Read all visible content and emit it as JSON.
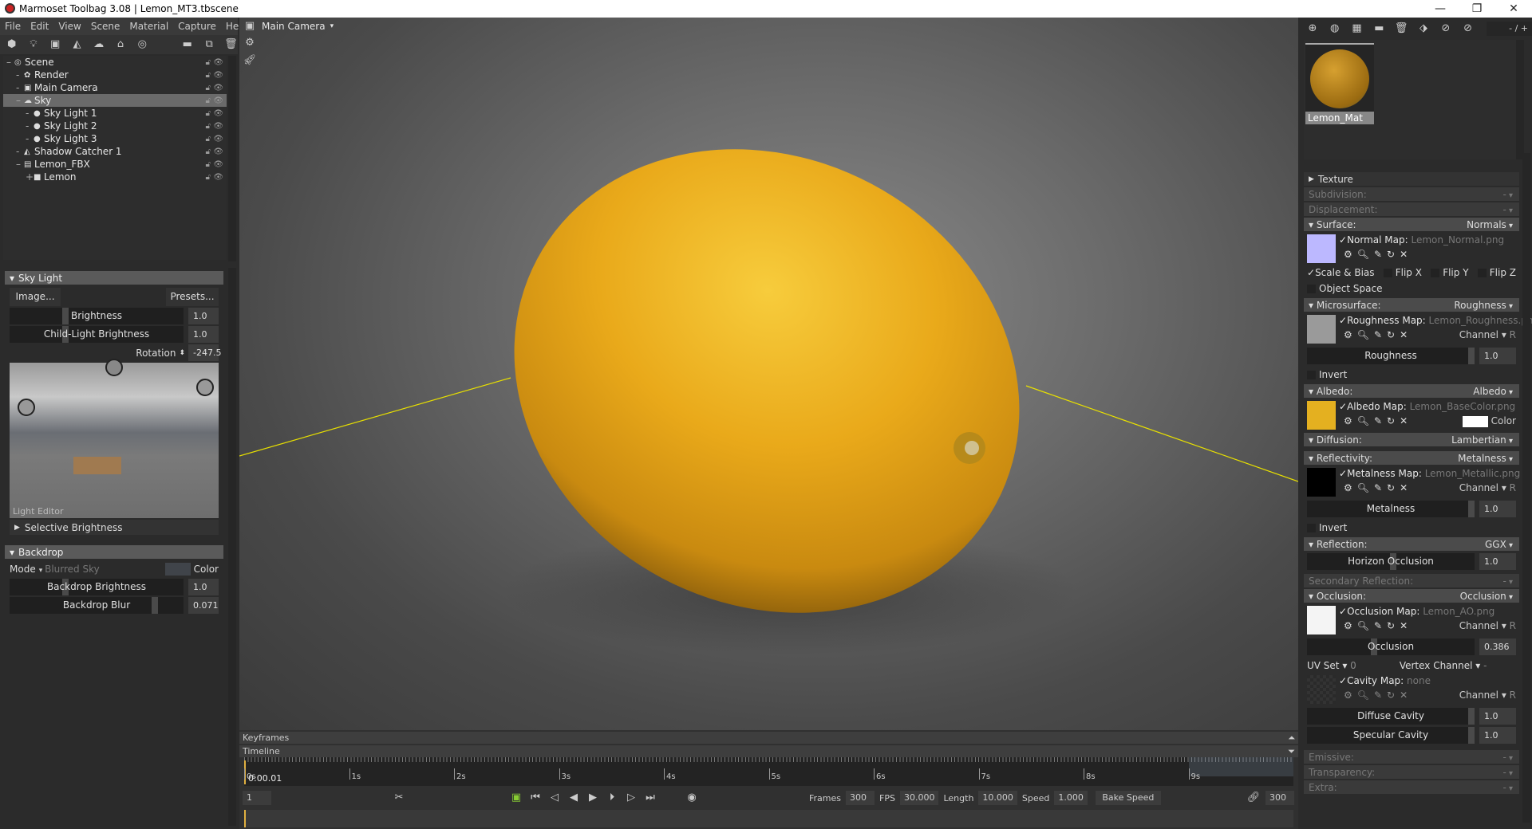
{
  "window": {
    "title": "Marmoset Toolbag 3.08  |  Lemon_MT3.tbscene",
    "minimize": "—",
    "restore": "❐",
    "close": "✕"
  },
  "menu": [
    "File",
    "Edit",
    "View",
    "Scene",
    "Material",
    "Capture",
    "Help"
  ],
  "scene_tree": [
    {
      "label": "Scene",
      "depth": 0,
      "prefix": "–",
      "icon": "◎"
    },
    {
      "label": "Render",
      "depth": 1,
      "prefix": "-",
      "icon": "✿"
    },
    {
      "label": "Main Camera",
      "depth": 1,
      "prefix": "-",
      "icon": "▣"
    },
    {
      "label": "Sky",
      "depth": 1,
      "prefix": "–",
      "icon": "☁",
      "selected": true
    },
    {
      "label": "Sky Light 1",
      "depth": 2,
      "prefix": "-",
      "icon": "●"
    },
    {
      "label": "Sky Light 2",
      "depth": 2,
      "prefix": "-",
      "icon": "●"
    },
    {
      "label": "Sky Light 3",
      "depth": 2,
      "prefix": "-",
      "icon": "●"
    },
    {
      "label": "Shadow Catcher 1",
      "depth": 1,
      "prefix": "-",
      "icon": "◭"
    },
    {
      "label": "Lemon_FBX",
      "depth": 1,
      "prefix": "–",
      "icon": "▤"
    },
    {
      "label": "Lemon",
      "depth": 2,
      "prefix": "+",
      "icon": "■"
    }
  ],
  "skylight": {
    "header": "Sky Light",
    "image_btn": "Image...",
    "presets_btn": "Presets...",
    "brightness_label": "Brightness",
    "brightness": "1.0",
    "child_label": "Child-Light Brightness",
    "child": "1.0",
    "rotation_label": "Rotation",
    "rotation": "-247.5",
    "light_editor": "Light Editor",
    "selective": "Selective Brightness"
  },
  "backdrop": {
    "header": "Backdrop",
    "mode_label": "Mode",
    "mode_value": "Blurred Sky",
    "color_label": "Color",
    "brightness_label": "Backdrop Brightness",
    "brightness": "1.0",
    "blur_label": "Backdrop Blur",
    "blur": "0.071"
  },
  "viewport": {
    "camera": "Main Camera"
  },
  "timeline": {
    "keyframes": "Keyframes",
    "timeline": "Timeline",
    "ticks": [
      "0s",
      "1s",
      "2s",
      "3s",
      "4s",
      "5s",
      "6s",
      "7s",
      "8s",
      "9s"
    ],
    "current_time": "0:00.01",
    "frame": "1",
    "frames_label": "Frames",
    "frames": "300",
    "fps_label": "FPS",
    "fps": "30.000",
    "length_label": "Length",
    "length": "10.000",
    "speed_label": "Speed",
    "speed": "1.000",
    "bake": "Bake Speed",
    "end_frame": "300"
  },
  "material": {
    "name": "Lemon_Mat",
    "counter": "- / +",
    "texture": "Texture",
    "subdivision": "Subdivision:",
    "displacement": "Displacement:",
    "dash": "-",
    "surface": "Surface:",
    "surface_v": "Normals",
    "normal_map": "Normal Map:",
    "normal_file": "Lemon_Normal.png",
    "scale_bias": "Scale & Bias",
    "flipx": "Flip X",
    "flipy": "Flip Y",
    "flipz": "Flip Z",
    "object_space": "Object Space",
    "micro": "Microsurface:",
    "micro_v": "Roughness",
    "rough_map": "Roughness Map:",
    "rough_file": "Lemon_Roughness.png",
    "channel": "Channel",
    "R": "R",
    "roughness_label": "Roughness",
    "roughness": "1.0",
    "invert": "Invert",
    "albedo": "Albedo:",
    "albedo_v": "Albedo",
    "albedo_map": "Albedo Map:",
    "albedo_file": "Lemon_BaseColor.png",
    "color": "Color",
    "diffusion": "Diffusion:",
    "diffusion_v": "Lambertian",
    "reflectivity": "Reflectivity:",
    "reflectivity_v": "Metalness",
    "metal_map": "Metalness Map:",
    "metal_file": "Lemon_Metallic.png",
    "metal_label": "Metalness",
    "metal": "1.0",
    "reflection": "Reflection:",
    "reflection_v": "GGX",
    "horizon_label": "Horizon Occlusion",
    "horizon": "1.0",
    "secondary": "Secondary Reflection:",
    "occlusion": "Occlusion:",
    "occlusion_v": "Occlusion",
    "occ_map": "Occlusion Map:",
    "occ_file": "Lemon_AO.png",
    "occ_label": "Occlusion",
    "occ": "0.386",
    "uvset": "UV Set",
    "uvset_v": "0",
    "vertex_channel": "Vertex Channel",
    "vertex_v": "-",
    "cavity_map": "Cavity Map:",
    "cavity_file": "none",
    "diffuse_cavity_label": "Diffuse Cavity",
    "diffuse_cavity": "1.0",
    "specular_cavity_label": "Specular Cavity",
    "specular_cavity": "1.0",
    "emissive": "Emissive:",
    "transparency": "Transparency:",
    "extra": "Extra:"
  }
}
